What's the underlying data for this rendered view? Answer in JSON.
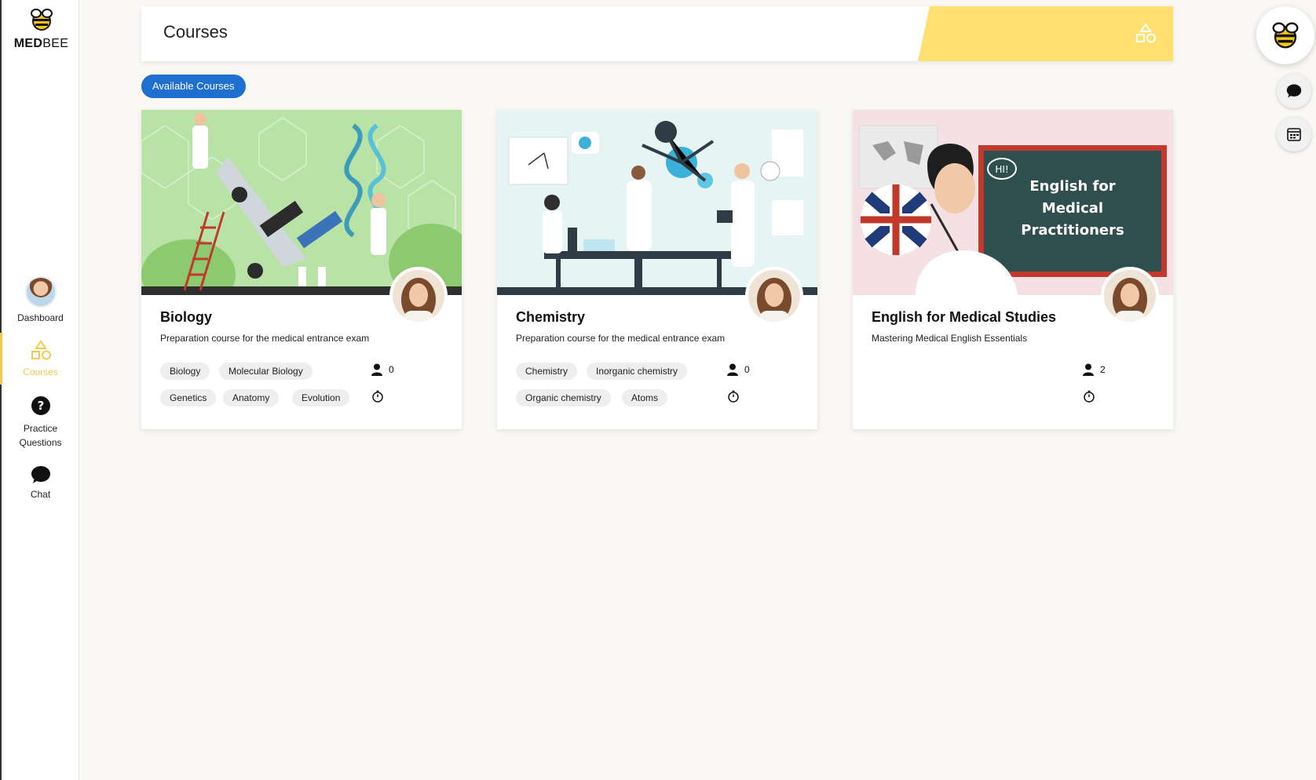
{
  "app": {
    "brand_bold": "MED",
    "brand_light": "BEE"
  },
  "sidebar": {
    "items": [
      {
        "label": "Dashboard",
        "icon": "user-avatar-icon"
      },
      {
        "label": "Courses",
        "icon": "shapes-icon",
        "active": true
      },
      {
        "label": "Practice\nQuestions",
        "label_line1": "Practice",
        "label_line2": "Questions",
        "icon": "question-icon"
      },
      {
        "label": "Chat",
        "icon": "chat-icon"
      }
    ]
  },
  "header": {
    "title": "Courses",
    "icon": "shapes-icon"
  },
  "filter": {
    "label": "Available Courses"
  },
  "colors": {
    "accent_yellow": "#fde070",
    "primary_blue": "#1e6fd0",
    "active_nav": "#f2c94c"
  },
  "courses": [
    {
      "title": "Biology",
      "description": "Preparation course for the medical entrance exam",
      "tags": [
        "Biology",
        "Molecular Biology",
        "Genetics",
        "Anatomy",
        "Evolution"
      ],
      "students": "0",
      "illustration": "biology-lab"
    },
    {
      "title": "Chemistry",
      "description": "Preparation course for the medical entrance exam",
      "tags": [
        "Chemistry",
        "Inorganic chemistry",
        "Organic chemistry",
        "Atoms"
      ],
      "students": "0",
      "illustration": "chemistry-lab"
    },
    {
      "title": "English for Medical Studies",
      "description": "Mastering Medical English Essentials",
      "tags": [],
      "students": "2",
      "illustration": "english-classroom",
      "board_text": [
        "English for",
        "Medical",
        "Practitioners"
      ],
      "speech_bubble": "HI!"
    }
  ]
}
